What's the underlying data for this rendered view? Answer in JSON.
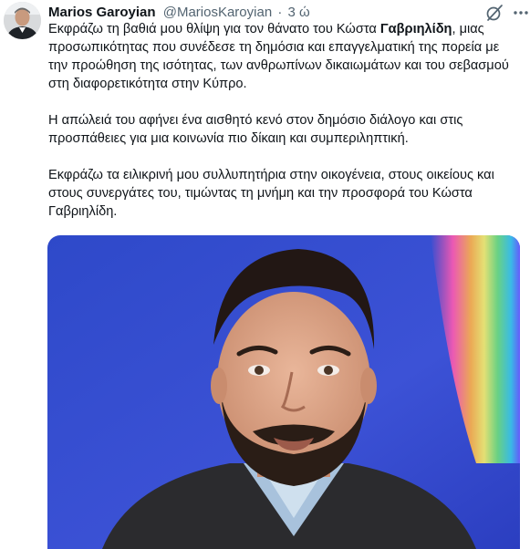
{
  "tweet": {
    "author": {
      "display_name": "Marios Garoyian",
      "handle": "@MariosKaroyian",
      "separator": "·",
      "timestamp": "3 ώ"
    },
    "icons": {
      "grok": "grok-icon",
      "more": "more-dots-icon"
    },
    "paragraphs": [
      {
        "before": "Εκφράζω τη βαθιά μου θλίψη για τον θάνατο του Κώστα ",
        "bold": "Γαβριηλίδη",
        "after": ", μιας προσωπικότητας που συνέδεσε τη δημόσια και επαγγελματική της πορεία με την προώθηση της ισότητας, των ανθρωπίνων δικαιωμάτων και του σεβασμού στη διαφορετικότητα στην Κύπρο."
      },
      {
        "text": "Η απώλειά του αφήνει ένα αισθητό κενό στον δημόσιο διάλογο και στις προσπάθειες για μια κοινωνία πιο δίκαιη και συμπεριληπτική."
      },
      {
        "text": "Εκφράζω τα ειλικρινή μου συλλυπητήρια στην οικογένεια, στους οικείους και στους συνεργάτες του, τιμώντας τη μνήμη και την προσφορά του Κώστα Γαβριηλίδη."
      }
    ],
    "colors": {
      "text": "#0f1419",
      "secondary": "#536471",
      "photo_background": "#3a4fd0"
    }
  }
}
